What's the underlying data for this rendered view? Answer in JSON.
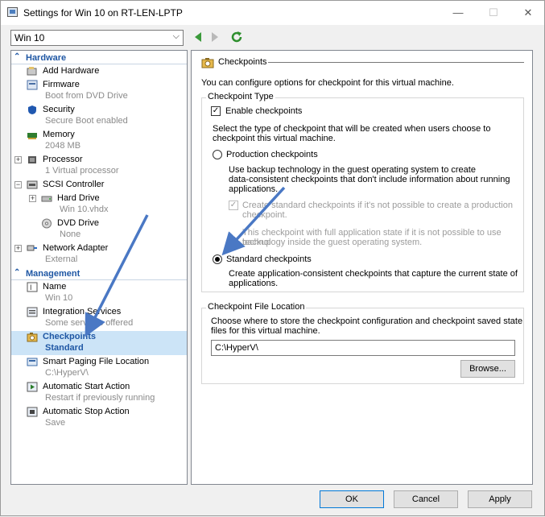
{
  "window": {
    "title": "Settings for Win 10 on RT-LEN-LPTP",
    "minimize": "—",
    "maximize": "☐",
    "close": "✕"
  },
  "vm_selector": {
    "value": "Win 10"
  },
  "tree": {
    "hardware_header": "Hardware",
    "management_header": "Management",
    "items": [
      {
        "label": "Add Hardware",
        "sub": ""
      },
      {
        "label": "Firmware",
        "sub": "Boot from DVD Drive"
      },
      {
        "label": "Security",
        "sub": "Secure Boot enabled"
      },
      {
        "label": "Memory",
        "sub": "2048 MB"
      },
      {
        "label": "Processor",
        "sub": "1 Virtual processor"
      },
      {
        "label": "SCSI Controller",
        "sub": ""
      },
      {
        "label": "Hard Drive",
        "sub": "Win 10.vhdx"
      },
      {
        "label": "DVD Drive",
        "sub": "None"
      },
      {
        "label": "Network Adapter",
        "sub": "External"
      },
      {
        "label": "Name",
        "sub": "Win 10"
      },
      {
        "label": "Integration Services",
        "sub": "Some services offered"
      },
      {
        "label": "Checkpoints",
        "sub": "Standard"
      },
      {
        "label": "Smart Paging File Location",
        "sub": "C:\\HyperV\\"
      },
      {
        "label": "Automatic Start Action",
        "sub": "Restart if previously running"
      },
      {
        "label": "Automatic Stop Action",
        "sub": "Save"
      }
    ]
  },
  "panel": {
    "title": "Checkpoints",
    "intro": "You can configure options for checkpoint for this virtual machine.",
    "type_group": {
      "label": "Checkpoint Type",
      "enable_label": "Enable checkpoints",
      "enable_checked": true,
      "select_text_1": "Select the type of checkpoint that will be created when users choose to",
      "select_text_2": "checkpoint this virtual machine.",
      "production_label": "Production checkpoints",
      "production_desc_1": "Use backup technology in the guest operating system to create",
      "production_desc_2": "data-consistent checkpoints that don't include information about running",
      "production_desc_3": "applications.",
      "fallback_label_1": "Create standard checkpoints if it's not possible to create a production",
      "fallback_label_2": "checkpoint.",
      "fallback_checked": true,
      "fallback_note_1": "This checkpoint with full application state if it is not possible to use backup",
      "fallback_note_2": "technology inside the guest operating system.",
      "standard_label": "Standard checkpoints",
      "standard_desc_1": "Create application-consistent checkpoints that capture the current state of",
      "standard_desc_2": "applications.",
      "selected": "standard"
    },
    "location_group": {
      "label": "Checkpoint File Location",
      "desc_1": "Choose where to store the checkpoint configuration and checkpoint saved state",
      "desc_2": "files for this virtual machine.",
      "path": "C:\\HyperV\\",
      "browse_label": "Browse..."
    }
  },
  "buttons": {
    "ok": "OK",
    "cancel": "Cancel",
    "apply": "Apply"
  },
  "colors": {
    "accent": "#1f57a4",
    "annotation_arrow": "#4a78c4",
    "selected_row": "#cce4f7"
  }
}
